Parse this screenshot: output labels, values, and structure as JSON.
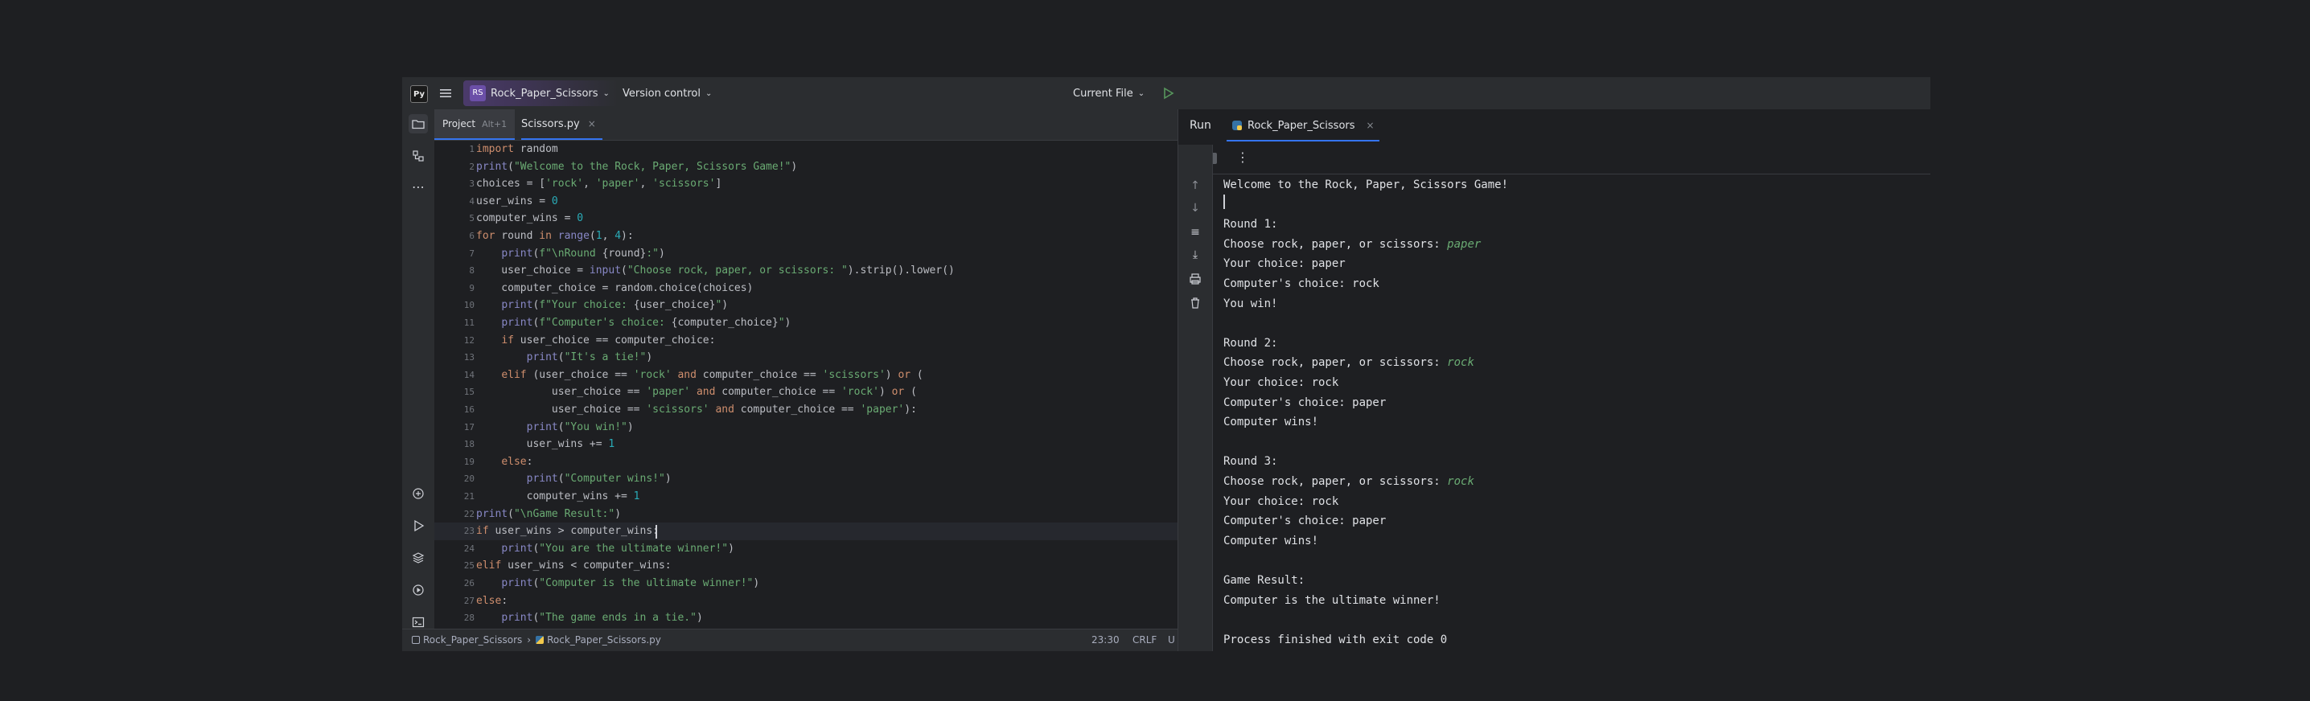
{
  "topbar": {
    "project_badge": "RS",
    "project_name": "Rock_Paper_Scissors",
    "vcs": "Version control",
    "run_config": "Current File"
  },
  "editor": {
    "project_tab_label": "Project",
    "project_tab_shortcut": "Alt+1",
    "file_tab": "Scissors.py"
  },
  "code": [
    [
      {
        "t": "import",
        "c": "kw"
      },
      {
        "t": " random"
      }
    ],
    [
      {
        "t": "print",
        "c": "bi"
      },
      {
        "t": "("
      },
      {
        "t": "\"Welcome to the Rock, Paper, Scissors Game!\"",
        "c": "st"
      },
      {
        "t": ")"
      }
    ],
    [
      {
        "t": "choices = ["
      },
      {
        "t": "'rock'",
        "c": "st"
      },
      {
        "t": ", "
      },
      {
        "t": "'paper'",
        "c": "st"
      },
      {
        "t": ", "
      },
      {
        "t": "'scissors'",
        "c": "st"
      },
      {
        "t": "]"
      }
    ],
    [
      {
        "t": "user_wins = "
      },
      {
        "t": "0",
        "c": "nm"
      }
    ],
    [
      {
        "t": "computer_wins = "
      },
      {
        "t": "0",
        "c": "nm"
      }
    ],
    [
      {
        "t": "for",
        "c": "kw"
      },
      {
        "t": " round "
      },
      {
        "t": "in",
        "c": "kw"
      },
      {
        "t": " "
      },
      {
        "t": "range",
        "c": "bi"
      },
      {
        "t": "("
      },
      {
        "t": "1",
        "c": "nm"
      },
      {
        "t": ", "
      },
      {
        "t": "4",
        "c": "nm"
      },
      {
        "t": "):"
      }
    ],
    [
      {
        "t": "    "
      },
      {
        "t": "print",
        "c": "bi"
      },
      {
        "t": "("
      },
      {
        "t": "f\"\\nRound ",
        "c": "st"
      },
      {
        "t": "{round}"
      },
      {
        "t": ":\"",
        "c": "st"
      },
      {
        "t": ")"
      }
    ],
    [
      {
        "t": "    user_choice = "
      },
      {
        "t": "input",
        "c": "bi"
      },
      {
        "t": "("
      },
      {
        "t": "\"Choose rock, paper, or scissors: \"",
        "c": "st"
      },
      {
        "t": ").strip().lower()"
      }
    ],
    [
      {
        "t": "    computer_choice = random.choice(choices)"
      }
    ],
    [
      {
        "t": "    "
      },
      {
        "t": "print",
        "c": "bi"
      },
      {
        "t": "("
      },
      {
        "t": "f\"Your choice: ",
        "c": "st"
      },
      {
        "t": "{user_choice}"
      },
      {
        "t": "\"",
        "c": "st"
      },
      {
        "t": ")"
      }
    ],
    [
      {
        "t": "    "
      },
      {
        "t": "print",
        "c": "bi"
      },
      {
        "t": "("
      },
      {
        "t": "f\"Computer's choice: ",
        "c": "st"
      },
      {
        "t": "{computer_choice}"
      },
      {
        "t": "\"",
        "c": "st"
      },
      {
        "t": ")"
      }
    ],
    [
      {
        "t": "    "
      },
      {
        "t": "if",
        "c": "kw"
      },
      {
        "t": " user_choice == computer_choice:"
      }
    ],
    [
      {
        "t": "        "
      },
      {
        "t": "print",
        "c": "bi"
      },
      {
        "t": "("
      },
      {
        "t": "\"It's a tie!\"",
        "c": "st"
      },
      {
        "t": ")"
      }
    ],
    [
      {
        "t": "    "
      },
      {
        "t": "elif",
        "c": "kw"
      },
      {
        "t": " (user_choice == "
      },
      {
        "t": "'rock'",
        "c": "st"
      },
      {
        "t": " "
      },
      {
        "t": "and",
        "c": "kw"
      },
      {
        "t": " computer_choice == "
      },
      {
        "t": "'scissors'",
        "c": "st"
      },
      {
        "t": ") "
      },
      {
        "t": "or",
        "c": "kw"
      },
      {
        "t": " ("
      }
    ],
    [
      {
        "t": "            user_choice == "
      },
      {
        "t": "'paper'",
        "c": "st"
      },
      {
        "t": " "
      },
      {
        "t": "and",
        "c": "kw"
      },
      {
        "t": " computer_choice == "
      },
      {
        "t": "'rock'",
        "c": "st"
      },
      {
        "t": ") "
      },
      {
        "t": "or",
        "c": "kw"
      },
      {
        "t": " ("
      }
    ],
    [
      {
        "t": "            user_choice == "
      },
      {
        "t": "'scissors'",
        "c": "st"
      },
      {
        "t": " "
      },
      {
        "t": "and",
        "c": "kw"
      },
      {
        "t": " computer_choice == "
      },
      {
        "t": "'paper'",
        "c": "st"
      },
      {
        "t": "):"
      }
    ],
    [
      {
        "t": "        "
      },
      {
        "t": "print",
        "c": "bi"
      },
      {
        "t": "("
      },
      {
        "t": "\"You win!\"",
        "c": "st"
      },
      {
        "t": ")"
      }
    ],
    [
      {
        "t": "        user_wins += "
      },
      {
        "t": "1",
        "c": "nm"
      }
    ],
    [
      {
        "t": "    "
      },
      {
        "t": "else",
        "c": "kw"
      },
      {
        "t": ":"
      }
    ],
    [
      {
        "t": "        "
      },
      {
        "t": "print",
        "c": "bi"
      },
      {
        "t": "("
      },
      {
        "t": "\"Computer wins!\"",
        "c": "st"
      },
      {
        "t": ")"
      }
    ],
    [
      {
        "t": "        computer_wins += "
      },
      {
        "t": "1",
        "c": "nm"
      }
    ],
    [
      {
        "t": "print",
        "c": "bi"
      },
      {
        "t": "("
      },
      {
        "t": "\"\\nGame Result:\"",
        "c": "st"
      },
      {
        "t": ")"
      }
    ],
    [
      {
        "t": "if",
        "c": "kw"
      },
      {
        "t": " user_wins > computer_wins:"
      }
    ],
    [
      {
        "t": "    "
      },
      {
        "t": "print",
        "c": "bi"
      },
      {
        "t": "("
      },
      {
        "t": "\"You are the ultimate winner!\"",
        "c": "st"
      },
      {
        "t": ")"
      }
    ],
    [
      {
        "t": "elif",
        "c": "kw"
      },
      {
        "t": " user_wins < computer_wins:"
      }
    ],
    [
      {
        "t": "    "
      },
      {
        "t": "print",
        "c": "bi"
      },
      {
        "t": "("
      },
      {
        "t": "\"Computer is the ultimate winner!\"",
        "c": "st"
      },
      {
        "t": ")"
      }
    ],
    [
      {
        "t": "else",
        "c": "kw"
      },
      {
        "t": ":"
      }
    ],
    [
      {
        "t": "    "
      },
      {
        "t": "print",
        "c": "bi"
      },
      {
        "t": "("
      },
      {
        "t": "\"The game ends in a tie.\"",
        "c": "st"
      },
      {
        "t": ")"
      }
    ]
  ],
  "statusbar": {
    "breadcrumb_project": "Rock_Paper_Scissors",
    "breadcrumb_file": "Rock_Paper_Scissors.py",
    "position": "23:30",
    "line_sep": "CRLF"
  },
  "run_panel": {
    "title": "Run",
    "tab": "Rock_Paper_Scissors"
  },
  "console": [
    [
      {
        "t": "Welcome to the Rock, Paper, Scissors Game!"
      }
    ],
    [],
    [
      {
        "t": "Round 1:"
      }
    ],
    [
      {
        "t": "Choose rock, paper, or scissors: "
      },
      {
        "t": "paper",
        "c": "cin"
      }
    ],
    [
      {
        "t": "Your choice: paper"
      }
    ],
    [
      {
        "t": "Computer's choice: rock"
      }
    ],
    [
      {
        "t": "You win!"
      }
    ],
    [],
    [
      {
        "t": "Round 2:"
      }
    ],
    [
      {
        "t": "Choose rock, paper, or scissors: "
      },
      {
        "t": "rock",
        "c": "cin"
      }
    ],
    [
      {
        "t": "Your choice: rock"
      }
    ],
    [
      {
        "t": "Computer's choice: paper"
      }
    ],
    [
      {
        "t": "Computer wins!"
      }
    ],
    [],
    [
      {
        "t": "Round 3:"
      }
    ],
    [
      {
        "t": "Choose rock, paper, or scissors: "
      },
      {
        "t": "rock",
        "c": "cin"
      }
    ],
    [
      {
        "t": "Your choice: rock"
      }
    ],
    [
      {
        "t": "Computer's choice: paper"
      }
    ],
    [
      {
        "t": "Computer wins!"
      }
    ],
    [],
    [
      {
        "t": "Game Result:"
      }
    ],
    [
      {
        "t": "Computer is the ultimate winner!"
      }
    ],
    [],
    [
      {
        "t": "Process finished with exit code 0"
      }
    ]
  ],
  "colors": {
    "accent": "#3574f0",
    "background": "#1e1f22",
    "panel": "#2b2d30",
    "project_badge": "#5f4ba0"
  }
}
